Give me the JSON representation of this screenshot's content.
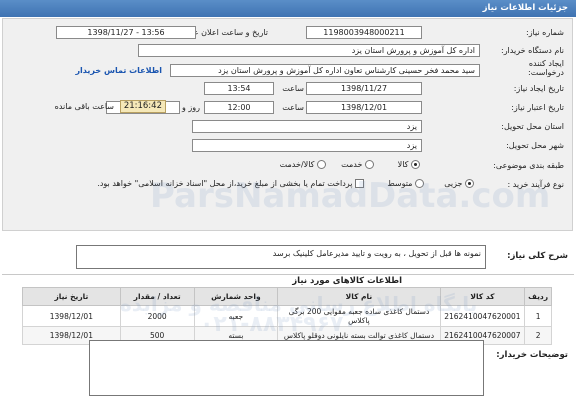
{
  "header": {
    "title": "جزئیات اطلاعات نیاز"
  },
  "form": {
    "need_number": {
      "label": "شماره نیاز:",
      "value": "1198003948000211"
    },
    "announce_datetime": {
      "label": "تاریخ و ساعت اعلان عمومی:",
      "value": "1398/11/27 - 13:56"
    },
    "buyer_org": {
      "label": "نام دستگاه خریدار:",
      "value": "اداره کل آموزش و پرورش استان یزد"
    },
    "requester": {
      "label_line1": "ایجاد کننده",
      "label_line2": "درخواست:",
      "value": "سید محمد فخر حسینی کارشناس تعاون اداره کل آموزش و پرورش استان یزد",
      "contact_link": "اطلاعات تماس خریدار"
    },
    "created": {
      "label": "تاریخ ایجاد نیاز:",
      "date": "1398/11/27",
      "time_label": "ساعت",
      "time": "13:54"
    },
    "deadline": {
      "label": "تاریخ اعتبار نیاز:",
      "date": "1398/12/01",
      "time_label": "ساعت",
      "time": "12:00",
      "days": "3",
      "days_label": "روز و",
      "remaining": "21:16:42",
      "remaining_label": "ساعت باقی مانده"
    },
    "province": {
      "label": "استان محل تحویل:",
      "value": "یزد"
    },
    "city": {
      "label": "شهر محل تحویل:",
      "value": "یزد"
    },
    "category": {
      "label": "طبقه بندی موضوعی:",
      "options": [
        "کالا",
        "خدمت",
        "کالا/خدمت"
      ],
      "selected": "کالا"
    },
    "purchase_type": {
      "label": "نوع فرآیند خرید :",
      "options": [
        "جزیی",
        "متوسط"
      ],
      "selected": "جزیی",
      "checkbox_text": "پرداخت تمام یا بخشی از مبلغ خرید،از محل \"اسناد خزانه اسلامی\" خواهد بود."
    }
  },
  "general_desc": {
    "label": "شرح کلی نیاز:",
    "value": "نمونه ها قبل از تحویل ، به رویت و تایید مدیرعامل کلینیک برسد"
  },
  "items_section": {
    "title": "اطلاعات کالاهای مورد نیاز"
  },
  "table": {
    "headers": [
      "ردیف",
      "کد کالا",
      "نام کالا",
      "واحد شمارش",
      "تعداد / مقدار",
      "تاریخ نیاز"
    ],
    "rows": [
      [
        "1",
        "2162410047620001",
        "دستمال کاغذی ساده جعبه مقوایی 200 برگی پاکلاس",
        "جعبه",
        "2000",
        "1398/12/01"
      ],
      [
        "2",
        "2162410047620007",
        "دستمال کاغذی توالت بسته نایلونی دوقلو پاکلاس",
        "بسته",
        "500",
        "1398/12/01"
      ]
    ]
  },
  "buyer_notes": {
    "label": "توضیحات خریدار:",
    "value": ""
  },
  "watermark": {
    "line1": "ParsNamadData.com",
    "line2": "پایگاه اطلاع رسانی مناقصه و مزایده",
    "line3": "۰۲۱-۸۸۳۴۹۶۷۰"
  }
}
